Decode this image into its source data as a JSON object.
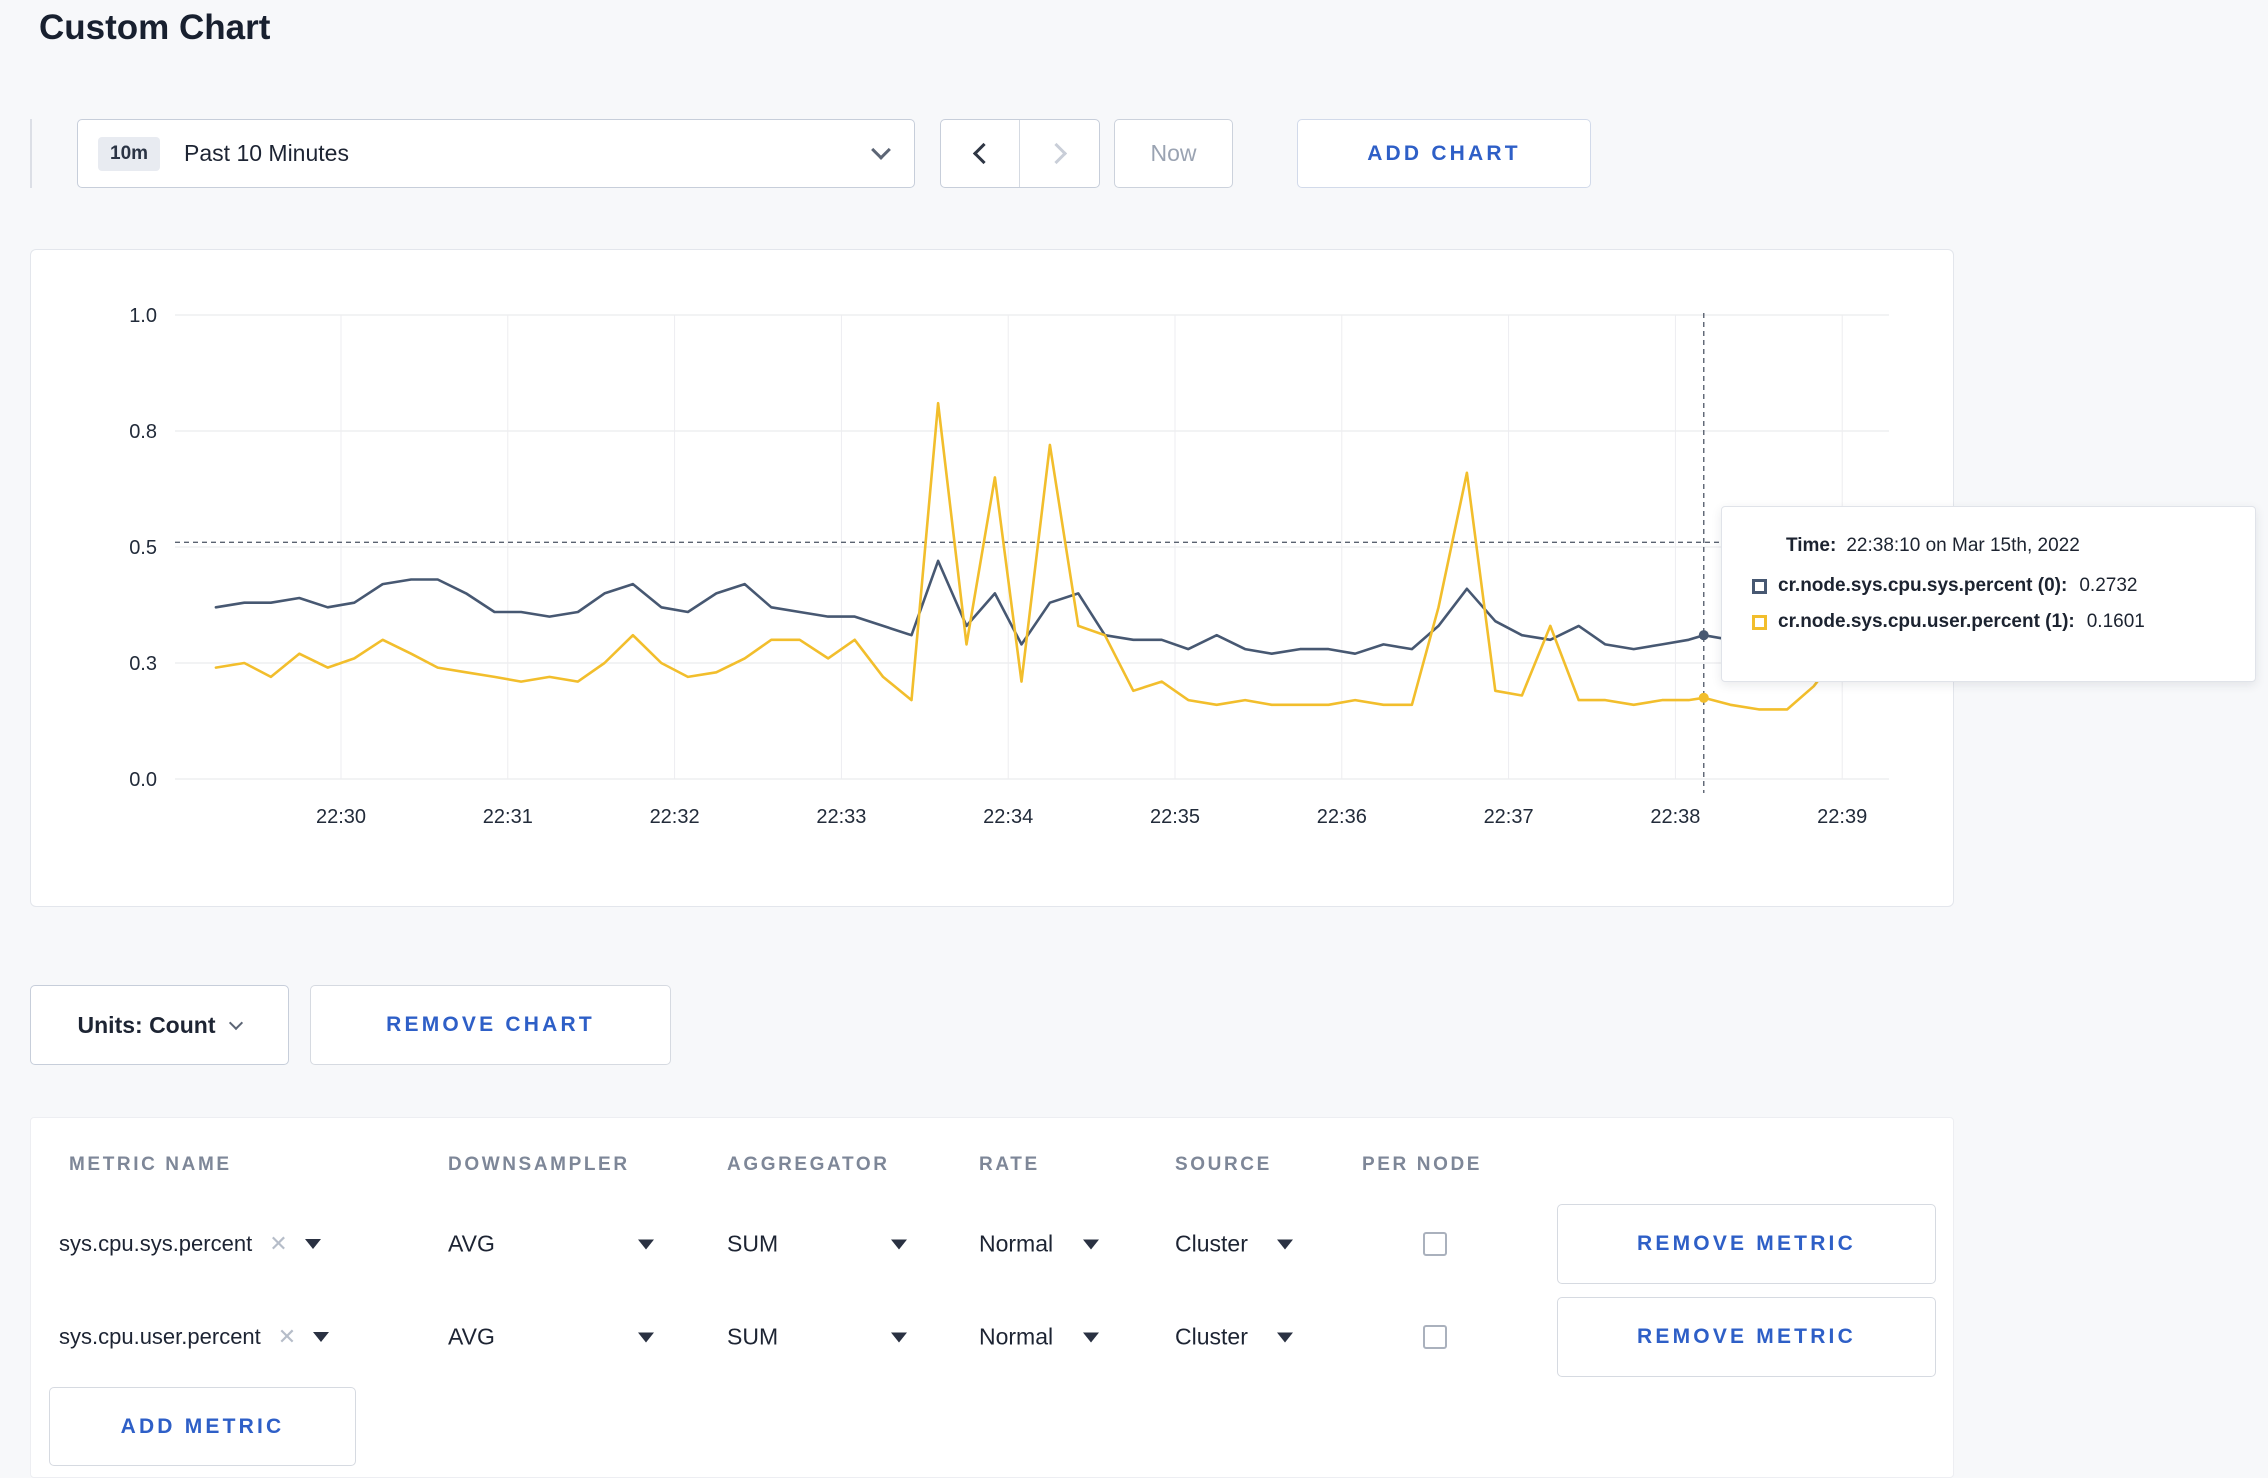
{
  "page": {
    "title": "Custom Chart"
  },
  "toolbar": {
    "time_badge": "10m",
    "time_label": "Past 10 Minutes",
    "now_label": "Now",
    "add_chart_label": "ADD CHART"
  },
  "chart_controls": {
    "units_label": "Units: Count",
    "remove_chart_label": "REMOVE CHART"
  },
  "tooltip": {
    "time_label": "Time:",
    "time_value": "22:38:10 on Mar 15th, 2022",
    "series": [
      {
        "name": "cr.node.sys.cpu.sys.percent (0):",
        "value": "0.2732",
        "color": "#475872"
      },
      {
        "name": "cr.node.sys.cpu.user.percent (1):",
        "value": "0.1601",
        "color": "#f2be2c"
      }
    ]
  },
  "chart_data": {
    "type": "line",
    "title": "",
    "xlabel": "",
    "ylabel": "",
    "ylim": [
      0,
      1
    ],
    "grid": true,
    "legend_position": "tooltip",
    "x_ticks": [
      {
        "m": 30,
        "label": "22:30"
      },
      {
        "m": 31,
        "label": "22:31"
      },
      {
        "m": 32,
        "label": "22:32"
      },
      {
        "m": 33,
        "label": "22:33"
      },
      {
        "m": 34,
        "label": "22:34"
      },
      {
        "m": 35,
        "label": "22:35"
      },
      {
        "m": 36,
        "label": "22:36"
      },
      {
        "m": 37,
        "label": "22:37"
      },
      {
        "m": 38,
        "label": "22:38"
      },
      {
        "m": 39,
        "label": "22:39"
      }
    ],
    "y_ticks": [
      {
        "v": 0,
        "label": "0.0"
      },
      {
        "v": 0.25,
        "label": "0.3"
      },
      {
        "v": 0.5,
        "label": "0.5"
      },
      {
        "v": 0.75,
        "label": "0.8"
      },
      {
        "v": 1,
        "label": "1.0"
      }
    ],
    "crosshair": {
      "x": 38.17,
      "y": 0.51
    },
    "series": [
      {
        "name": "cr.node.sys.cpu.sys.percent",
        "color": "#475872",
        "points": [
          [
            29.25,
            0.37
          ],
          [
            29.42,
            0.38
          ],
          [
            29.58,
            0.38
          ],
          [
            29.75,
            0.39
          ],
          [
            29.92,
            0.37
          ],
          [
            30.08,
            0.38
          ],
          [
            30.25,
            0.42
          ],
          [
            30.42,
            0.43
          ],
          [
            30.58,
            0.43
          ],
          [
            30.75,
            0.4
          ],
          [
            30.92,
            0.36
          ],
          [
            31.08,
            0.36
          ],
          [
            31.25,
            0.35
          ],
          [
            31.42,
            0.36
          ],
          [
            31.58,
            0.4
          ],
          [
            31.75,
            0.42
          ],
          [
            31.92,
            0.37
          ],
          [
            32.08,
            0.36
          ],
          [
            32.25,
            0.4
          ],
          [
            32.42,
            0.42
          ],
          [
            32.58,
            0.37
          ],
          [
            32.75,
            0.36
          ],
          [
            32.92,
            0.35
          ],
          [
            33.08,
            0.35
          ],
          [
            33.25,
            0.33
          ],
          [
            33.42,
            0.31
          ],
          [
            33.58,
            0.47
          ],
          [
            33.75,
            0.33
          ],
          [
            33.92,
            0.4
          ],
          [
            34.08,
            0.29
          ],
          [
            34.25,
            0.38
          ],
          [
            34.42,
            0.4
          ],
          [
            34.58,
            0.31
          ],
          [
            34.75,
            0.3
          ],
          [
            34.92,
            0.3
          ],
          [
            35.08,
            0.28
          ],
          [
            35.25,
            0.31
          ],
          [
            35.42,
            0.28
          ],
          [
            35.58,
            0.27
          ],
          [
            35.75,
            0.28
          ],
          [
            35.92,
            0.28
          ],
          [
            36.08,
            0.27
          ],
          [
            36.25,
            0.29
          ],
          [
            36.42,
            0.28
          ],
          [
            36.58,
            0.33
          ],
          [
            36.75,
            0.41
          ],
          [
            36.92,
            0.34
          ],
          [
            37.08,
            0.31
          ],
          [
            37.25,
            0.3
          ],
          [
            37.42,
            0.33
          ],
          [
            37.58,
            0.29
          ],
          [
            37.75,
            0.28
          ],
          [
            37.92,
            0.29
          ],
          [
            38.08,
            0.3
          ],
          [
            38.17,
            0.31
          ],
          [
            38.33,
            0.3
          ],
          [
            38.5,
            0.31
          ],
          [
            38.67,
            0.3
          ],
          [
            38.83,
            0.3
          ],
          [
            39.0,
            0.31
          ],
          [
            39.1,
            0.3
          ]
        ]
      },
      {
        "name": "cr.node.sys.cpu.user.percent",
        "color": "#f2be2c",
        "points": [
          [
            29.25,
            0.24
          ],
          [
            29.42,
            0.25
          ],
          [
            29.58,
            0.22
          ],
          [
            29.75,
            0.27
          ],
          [
            29.92,
            0.24
          ],
          [
            30.08,
            0.26
          ],
          [
            30.25,
            0.3
          ],
          [
            30.42,
            0.27
          ],
          [
            30.58,
            0.24
          ],
          [
            30.75,
            0.23
          ],
          [
            30.92,
            0.22
          ],
          [
            31.08,
            0.21
          ],
          [
            31.25,
            0.22
          ],
          [
            31.42,
            0.21
          ],
          [
            31.58,
            0.25
          ],
          [
            31.75,
            0.31
          ],
          [
            31.92,
            0.25
          ],
          [
            32.08,
            0.22
          ],
          [
            32.25,
            0.23
          ],
          [
            32.42,
            0.26
          ],
          [
            32.58,
            0.3
          ],
          [
            32.75,
            0.3
          ],
          [
            32.92,
            0.26
          ],
          [
            33.08,
            0.3
          ],
          [
            33.25,
            0.22
          ],
          [
            33.42,
            0.17
          ],
          [
            33.58,
            0.81
          ],
          [
            33.75,
            0.29
          ],
          [
            33.92,
            0.65
          ],
          [
            34.08,
            0.21
          ],
          [
            34.25,
            0.72
          ],
          [
            34.42,
            0.33
          ],
          [
            34.58,
            0.31
          ],
          [
            34.75,
            0.19
          ],
          [
            34.92,
            0.21
          ],
          [
            35.08,
            0.17
          ],
          [
            35.25,
            0.16
          ],
          [
            35.42,
            0.17
          ],
          [
            35.58,
            0.16
          ],
          [
            35.75,
            0.16
          ],
          [
            35.92,
            0.16
          ],
          [
            36.08,
            0.17
          ],
          [
            36.25,
            0.16
          ],
          [
            36.42,
            0.16
          ],
          [
            36.58,
            0.37
          ],
          [
            36.75,
            0.66
          ],
          [
            36.92,
            0.19
          ],
          [
            37.08,
            0.18
          ],
          [
            37.25,
            0.33
          ],
          [
            37.42,
            0.17
          ],
          [
            37.58,
            0.17
          ],
          [
            37.75,
            0.16
          ],
          [
            37.92,
            0.17
          ],
          [
            38.08,
            0.17
          ],
          [
            38.17,
            0.175
          ],
          [
            38.33,
            0.16
          ],
          [
            38.5,
            0.15
          ],
          [
            38.67,
            0.15
          ],
          [
            38.83,
            0.2
          ],
          [
            39.0,
            0.28
          ],
          [
            39.1,
            0.24
          ]
        ]
      }
    ]
  },
  "metrics_table": {
    "headers": [
      "METRIC NAME",
      "DOWNSAMPLER",
      "AGGREGATOR",
      "RATE",
      "SOURCE",
      "PER NODE"
    ],
    "rows": [
      {
        "metric": "sys.cpu.sys.percent",
        "downsampler": "AVG",
        "aggregator": "SUM",
        "rate": "Normal",
        "source": "Cluster",
        "per_node_checked": false,
        "remove_label": "REMOVE METRIC"
      },
      {
        "metric": "sys.cpu.user.percent",
        "downsampler": "AVG",
        "aggregator": "SUM",
        "rate": "Normal",
        "source": "Cluster",
        "per_node_checked": false,
        "remove_label": "REMOVE METRIC"
      }
    ],
    "add_metric_label": "ADD METRIC"
  }
}
